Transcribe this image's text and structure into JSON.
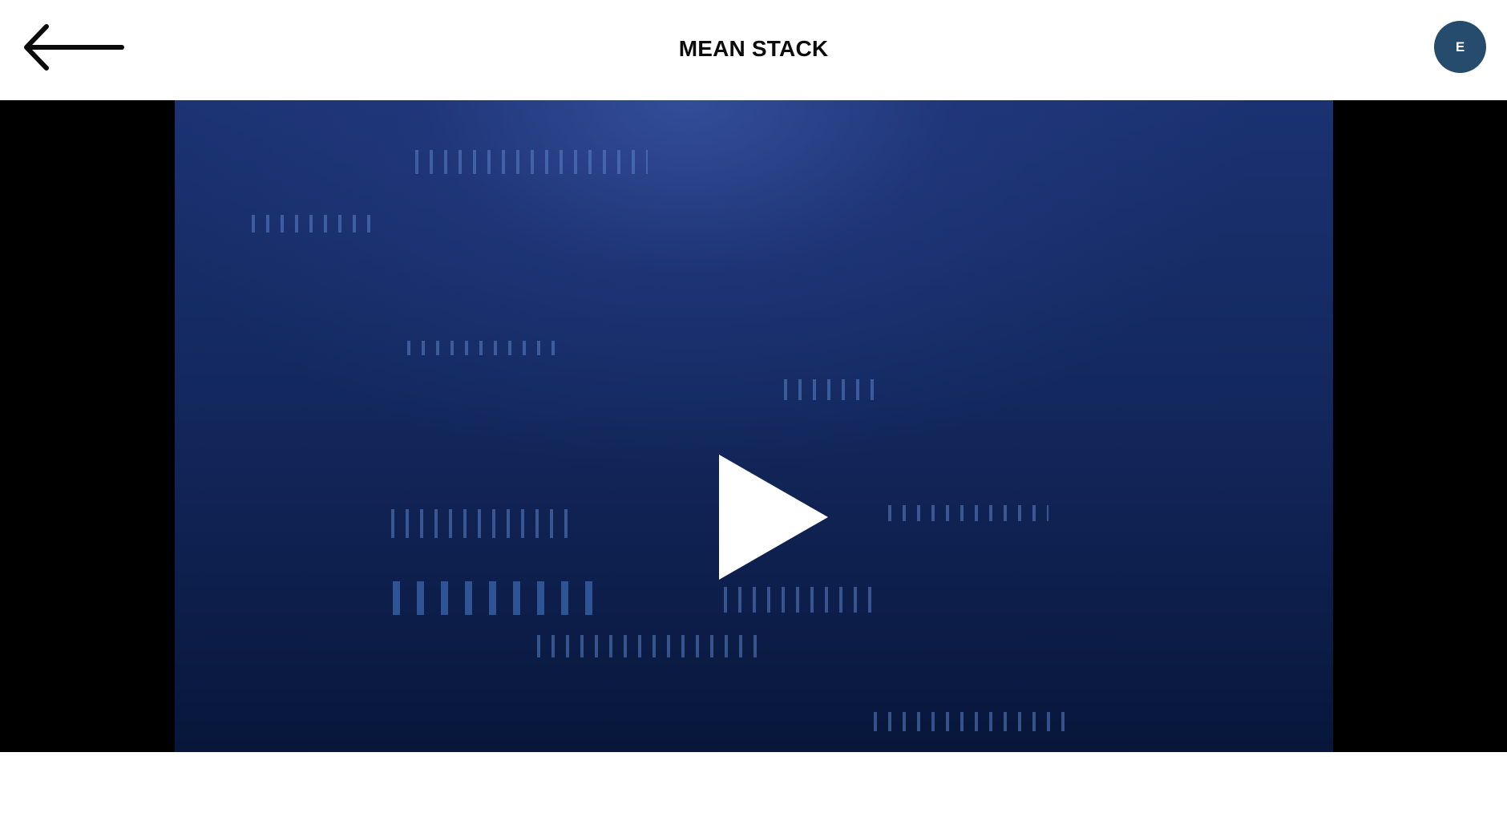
{
  "header": {
    "title": "MEAN STACK",
    "back_icon": "arrow-left-icon",
    "avatar_initial": "E"
  },
  "video": {
    "state": "paused",
    "play_icon": "play-icon"
  },
  "colors": {
    "avatar_bg": "#264c6d",
    "video_bg": "#13285e",
    "letterbox": "#000000"
  }
}
